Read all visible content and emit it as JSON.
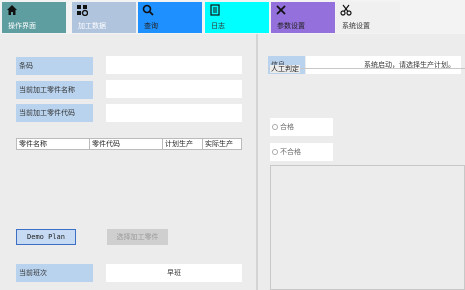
{
  "toolbar": {
    "buttons": [
      {
        "label": "操作界面",
        "icon": "home-icon",
        "color": "#5f9ea0"
      },
      {
        "label": "加工数据",
        "icon": "tools-icon",
        "color": "#b0c4de"
      },
      {
        "label": "查询",
        "icon": "search-icon",
        "color": "#1e90ff"
      },
      {
        "label": "日志",
        "icon": "log-icon",
        "color": "#00ffff"
      },
      {
        "label": "参数设置",
        "icon": "wrench-icon",
        "color": "#9370db"
      },
      {
        "label": "系统设置",
        "icon": "scissors-icon",
        "color": "#f0f0f0"
      }
    ]
  },
  "left": {
    "barcode_label": "条码",
    "barcode_value": "",
    "part_name_label": "当前加工零件名称",
    "part_name_value": "",
    "part_code_label": "当前加工零件代码",
    "part_code_value": "",
    "table_headers": [
      "零件名称",
      "零件代码",
      "计划生产",
      "实际生产"
    ],
    "demo_button": "Demo Plan",
    "select_button": "选择加工零件",
    "shift_label": "当前班次",
    "shift_value": "早班"
  },
  "right": {
    "info_label": "信息",
    "info_value": "系统启动，请选择生产计划。",
    "judge_title": "人工判定",
    "pass_label": "合格",
    "fail_label": "不合格"
  }
}
